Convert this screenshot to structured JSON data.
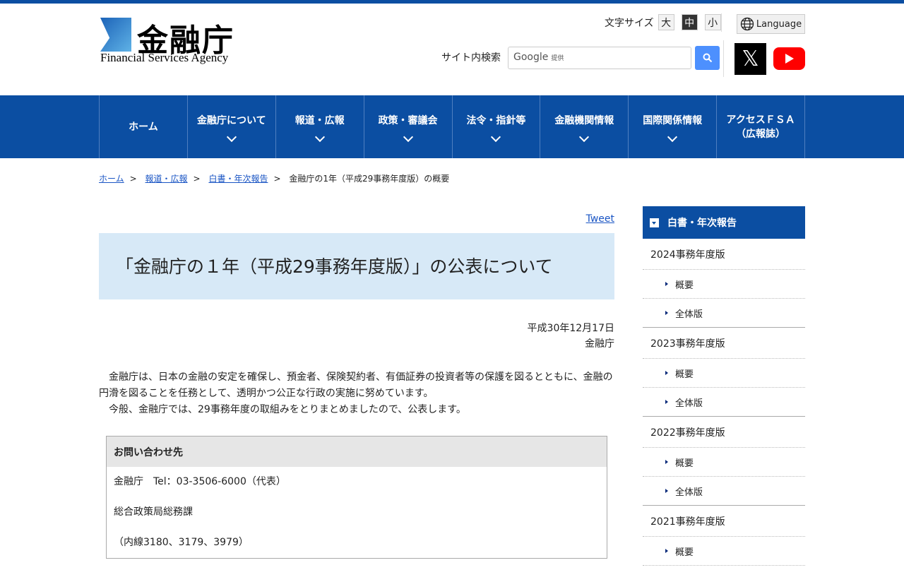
{
  "header": {
    "logo_kanji": "金融庁",
    "logo_en": "Financial Services Agency",
    "font_size_label": "文字サイズ",
    "font_sizes": [
      "大",
      "中",
      "小"
    ],
    "font_size_selected": "中",
    "language": "Language",
    "search_label": "サイト内検索",
    "search_placeholder": "Google",
    "search_provided": "提供"
  },
  "nav": [
    {
      "label": "ホーム",
      "dropdown": false
    },
    {
      "label": "金融庁について",
      "dropdown": true
    },
    {
      "label": "報道・広報",
      "dropdown": true
    },
    {
      "label": "政策・審議会",
      "dropdown": true
    },
    {
      "label": "法令・指針等",
      "dropdown": true
    },
    {
      "label": "金融機関情報",
      "dropdown": true
    },
    {
      "label": "国際関係情報",
      "dropdown": true
    },
    {
      "label": "アクセスＦＳＡ",
      "label2": "（広報誌）",
      "dropdown": false
    }
  ],
  "breadcrumb": [
    "ホーム",
    "報道・広報",
    "白書・年次報告"
  ],
  "breadcrumb_current": "金融庁の1年（平成29事務年度版）の概要",
  "main": {
    "tweet": "Tweet",
    "title": "「金融庁の１年（平成29事務年度版）」の公表について",
    "date": "平成30年12月17日",
    "org": "金融庁",
    "para1": "　金融庁は、日本の金融の安定を確保し、預金者、保険契約者、有価証券の投資者等の保護を図るとともに、金融の円滑を図ることを任務として、透明かつ公正な行政の実施に努めています。",
    "para2": "　今般、金融庁では、29事務年度の取組みをとりまとめましたので、公表します。",
    "contact": {
      "heading": "お問い合わせ先",
      "lines": [
        "金融庁　Tel：03-3506-6000（代表）",
        "総合政策局総務課",
        "（内線3180、3179、3979）"
      ]
    }
  },
  "sidebar": {
    "heading": "白書・年次報告",
    "years": [
      {
        "label": "2024事務年度版",
        "items": [
          "概要",
          "全体版"
        ]
      },
      {
        "label": "2023事務年度版",
        "items": [
          "概要",
          "全体版"
        ]
      },
      {
        "label": "2022事務年度版",
        "items": [
          "概要",
          "全体版"
        ]
      },
      {
        "label": "2021事務年度版",
        "items": [
          "概要"
        ]
      }
    ]
  },
  "colors": {
    "brand": "#0b4ea2",
    "title_bg": "#d7e9f7"
  }
}
